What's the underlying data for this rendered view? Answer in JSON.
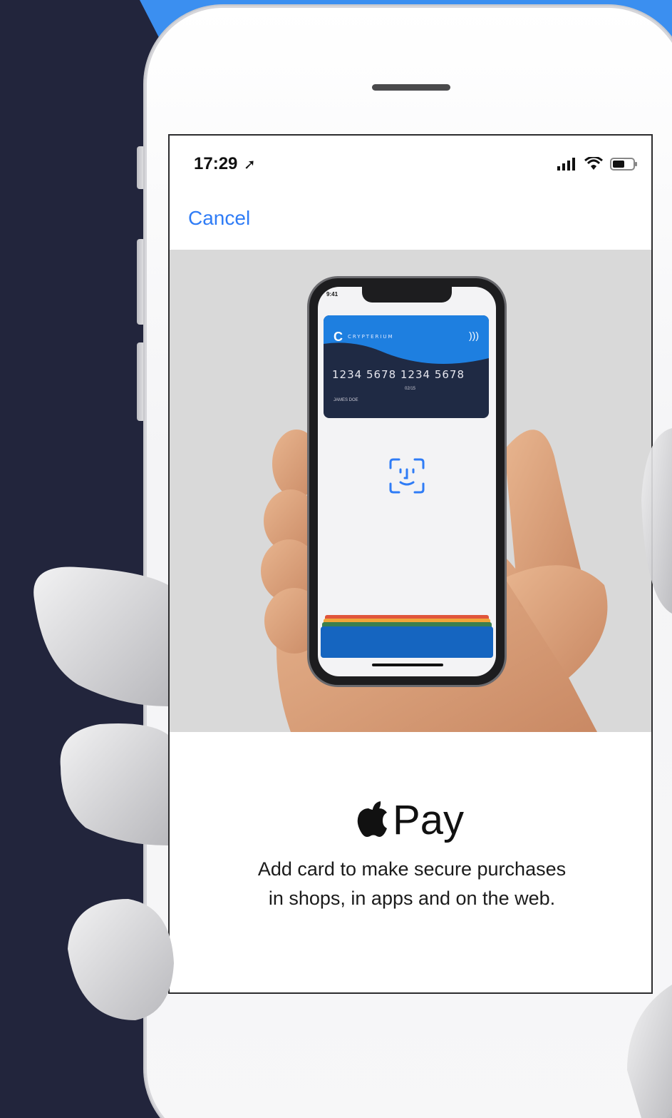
{
  "status_bar": {
    "time": "17:29",
    "location_icon": "location-arrow-icon",
    "icons": [
      "cellular-signal-icon",
      "wifi-icon",
      "battery-icon"
    ]
  },
  "nav": {
    "cancel_label": "Cancel"
  },
  "hero": {
    "card": {
      "brand": "CRYPTERIUM",
      "number": "1234  5678  1234  5678",
      "expiry": "02/15",
      "holder": "JAMES DOE"
    },
    "mini_time": "9:41"
  },
  "content": {
    "title": "Pay",
    "description": "Add card to make secure purchases in shops, in apps and on the web."
  },
  "colors": {
    "background": "#22253c",
    "accent_blue": "#3b8ff0",
    "link_blue": "#2f7cf6"
  }
}
